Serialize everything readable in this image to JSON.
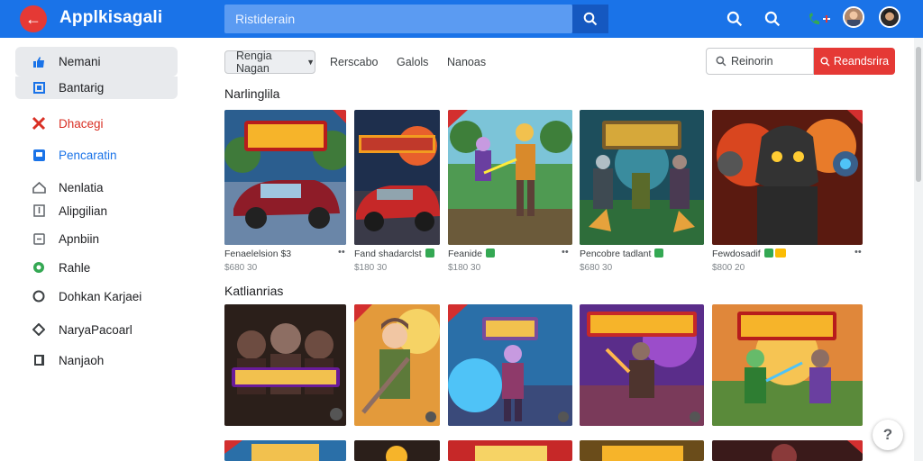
{
  "header": {
    "logo_glyph": "←",
    "app_title": "Applkisagali",
    "search_placeholder": "Ristiderain",
    "brand_color": "#1a73e8"
  },
  "sidebar": {
    "items": [
      {
        "label": "Nemani",
        "icon": "thumbs-up-icon",
        "highlighted": true,
        "color": "#1a73e8"
      },
      {
        "label": "Bantarig",
        "icon": "book-icon",
        "highlighted": true,
        "color": "#1a73e8"
      },
      {
        "label": "Dhacegi",
        "icon": "close-x-icon",
        "highlighted": false,
        "color": "#d93025"
      },
      {
        "label": "Pencaratin",
        "icon": "message-icon",
        "highlighted": false,
        "color": "#1a73e8"
      },
      {
        "label": "Nenlatia",
        "icon": "house-icon",
        "highlighted": false,
        "color": "#202124"
      },
      {
        "label": "Alipgilian",
        "icon": "download-icon",
        "highlighted": false,
        "color": "#202124"
      },
      {
        "label": "Apnbiin",
        "icon": "square-icon",
        "highlighted": false,
        "color": "#202124"
      },
      {
        "label": "Rahle",
        "icon": "location-pin-icon",
        "highlighted": false,
        "color": "#202124"
      },
      {
        "label": "Dohkan Karjaei",
        "icon": "circle-icon",
        "highlighted": false,
        "color": "#202124"
      },
      {
        "label": "NaryaPacoarl",
        "icon": "pin-icon",
        "highlighted": false,
        "color": "#202124"
      },
      {
        "label": "Nanjaoh",
        "icon": "book-dark-icon",
        "highlighted": false,
        "color": "#202124"
      }
    ]
  },
  "filters": {
    "active_chip": "Rengia Nagan",
    "chips": [
      "Rerscabo",
      "Galols",
      "Nanoas"
    ],
    "search_placeholder": "Reinorin",
    "search_button": "Reandsrira",
    "accent": "#e53935"
  },
  "sections": [
    {
      "title": "Narlinglila",
      "cards": [
        {
          "name": "Fenaelelsion",
          "suffix": "$3",
          "price": "$680 30",
          "badge": "none",
          "art": "car-red"
        },
        {
          "name": "Fand shadarclst",
          "suffix": "",
          "price": "$180 30",
          "badge": "green",
          "art": "car-dark"
        },
        {
          "name": "Feanide",
          "suffix": "",
          "price": "$180 30",
          "badge": "green",
          "art": "hero-green"
        },
        {
          "name": "Pencobre tadlant",
          "suffix": "",
          "price": "$680 30",
          "badge": "green",
          "art": "warriors-blue"
        },
        {
          "name": "Fewdosadif",
          "suffix": "",
          "price": "$800 20",
          "badge": "green-yellow",
          "art": "mech-fire"
        }
      ]
    },
    {
      "title": "Katlianrias",
      "cards": [
        {
          "art": "squad-dark"
        },
        {
          "art": "boy-hero"
        },
        {
          "art": "cyber-warrior"
        },
        {
          "art": "ninja-purple"
        },
        {
          "art": "battle-green"
        }
      ]
    }
  ],
  "help_label": "?"
}
